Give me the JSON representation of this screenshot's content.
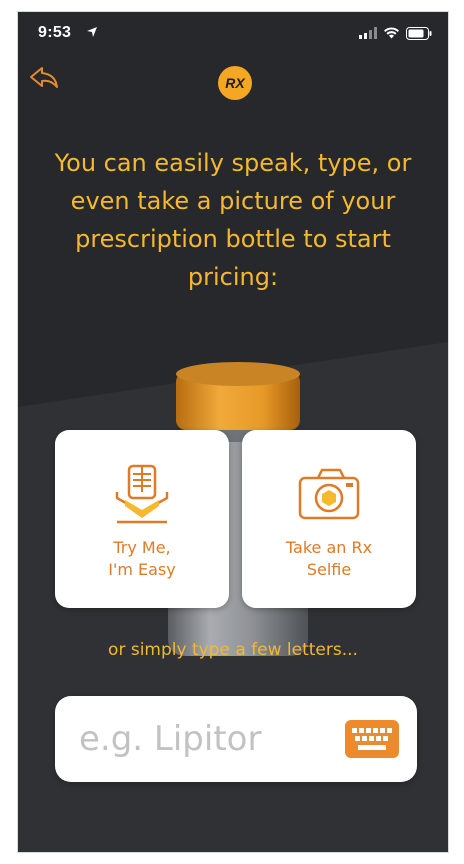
{
  "status_bar": {
    "time": "9:53",
    "icons": [
      "location-arrow-icon",
      "signal-bars-icon",
      "wifi-icon",
      "battery-icon"
    ]
  },
  "header": {
    "logo_text": "RX",
    "back_icon": "back-arrow-icon"
  },
  "main": {
    "headline": "You can easily speak, type, or even take a picture of your prescription bottle to start pricing:",
    "options": [
      {
        "label": "Try Me,\nI'm Easy",
        "icon": "microphone-icon"
      },
      {
        "label": "Take an Rx\nSelfie",
        "icon": "camera-icon"
      }
    ],
    "type_prompt": "or simply type a few letters...",
    "search": {
      "placeholder": "e.g. Lipitor",
      "value": "",
      "icon": "keyboard-icon"
    }
  },
  "colors": {
    "background": "#26282b",
    "accent": "#f5b82e",
    "orange": "#ec8a2c",
    "card": "#ffffff"
  }
}
